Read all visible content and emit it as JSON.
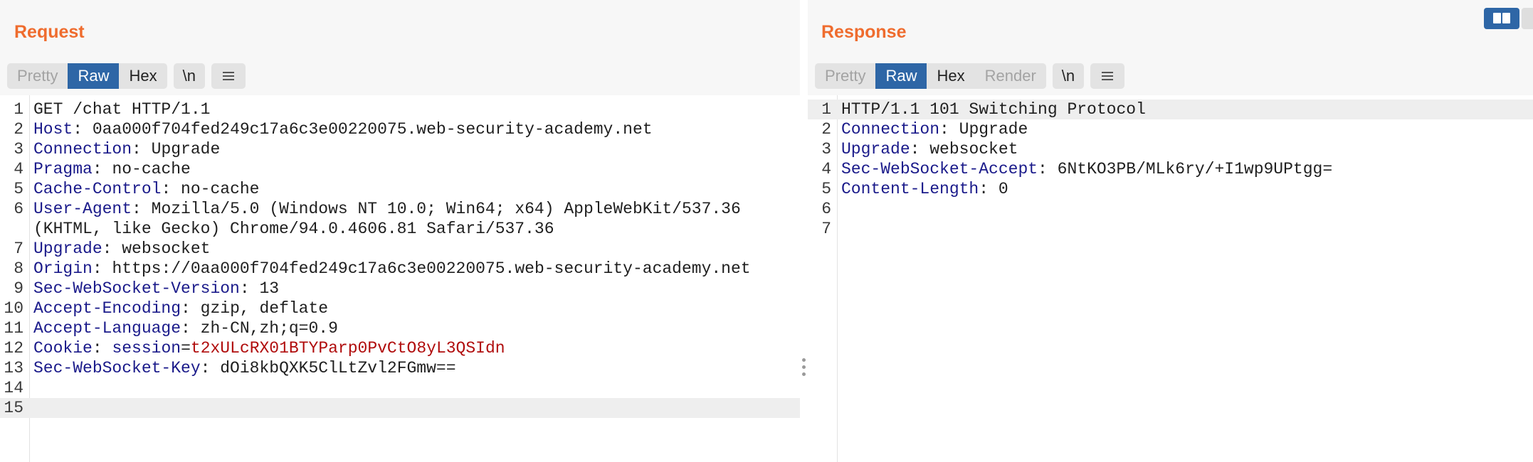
{
  "request": {
    "title": "Request",
    "tabs": [
      "Pretty",
      "Raw",
      "Hex"
    ],
    "active_tab": "Raw",
    "newline_button": "\\n",
    "menu_icon": "hamburger-menu-icon",
    "lines": [
      {
        "num": "1",
        "text": "GET /chat HTTP/1.1"
      },
      {
        "num": "2",
        "name": "Host",
        "value": " 0aa000f704fed249c17a6c3e00220075.web-security-academy.net"
      },
      {
        "num": "3",
        "name": "Connection",
        "value": " Upgrade"
      },
      {
        "num": "4",
        "name": "Pragma",
        "value": " no-cache"
      },
      {
        "num": "5",
        "name": "Cache-Control",
        "value": " no-cache"
      },
      {
        "num": "6",
        "name": "User-Agent",
        "value": " Mozilla/5.0 (Windows NT 10.0; Win64; x64) AppleWebKit/537.36"
      },
      {
        "num": "",
        "text": "(KHTML, like Gecko) Chrome/94.0.4606.81 Safari/537.36"
      },
      {
        "num": "7",
        "name": "Upgrade",
        "value": " websocket"
      },
      {
        "num": "8",
        "name": "Origin",
        "value": " https://0aa000f704fed249c17a6c3e00220075.web-security-academy.net"
      },
      {
        "num": "9",
        "name": "Sec-WebSocket-Version",
        "value": " 13"
      },
      {
        "num": "10",
        "name": "Accept-Encoding",
        "value": " gzip, deflate"
      },
      {
        "num": "11",
        "name": "Accept-Language",
        "value": " zh-CN,zh;q=0.9"
      },
      {
        "num": "12",
        "name": "Cookie",
        "cookie_name": "session",
        "cookie_value": "t2xULcRX01BTYParp0PvCtO8yL3QSIdn"
      },
      {
        "num": "13",
        "name": "Sec-WebSocket-Key",
        "value": " dOi8kbQXK5ClLtZvl2FGmw=="
      },
      {
        "num": "14",
        "text": ""
      },
      {
        "num": "15",
        "text": "",
        "highlight": true
      }
    ]
  },
  "response": {
    "title": "Response",
    "tabs": [
      "Pretty",
      "Raw",
      "Hex",
      "Render"
    ],
    "active_tab": "Raw",
    "newline_button": "\\n",
    "menu_icon": "hamburger-menu-icon",
    "lines": [
      {
        "num": "1",
        "text": "HTTP/1.1 101 Switching Protocol",
        "highlight": true
      },
      {
        "num": "2",
        "name": "Connection",
        "value": " Upgrade"
      },
      {
        "num": "3",
        "name": "Upgrade",
        "value": " websocket"
      },
      {
        "num": "4",
        "name": "Sec-WebSocket-Accept",
        "value": " 6NtKO3PB/MLk6ry/+I1wp9UPtgg="
      },
      {
        "num": "5",
        "name": "Content-Length",
        "value": " 0"
      },
      {
        "num": "6",
        "text": ""
      },
      {
        "num": "7",
        "text": ""
      }
    ]
  },
  "colors": {
    "accent": "#ef6c2e",
    "active_tab": "#2e66a6",
    "header_name": "#1a1a8a",
    "cookie_value": "#b00c0c"
  },
  "layout_icon": "split-view-icon"
}
